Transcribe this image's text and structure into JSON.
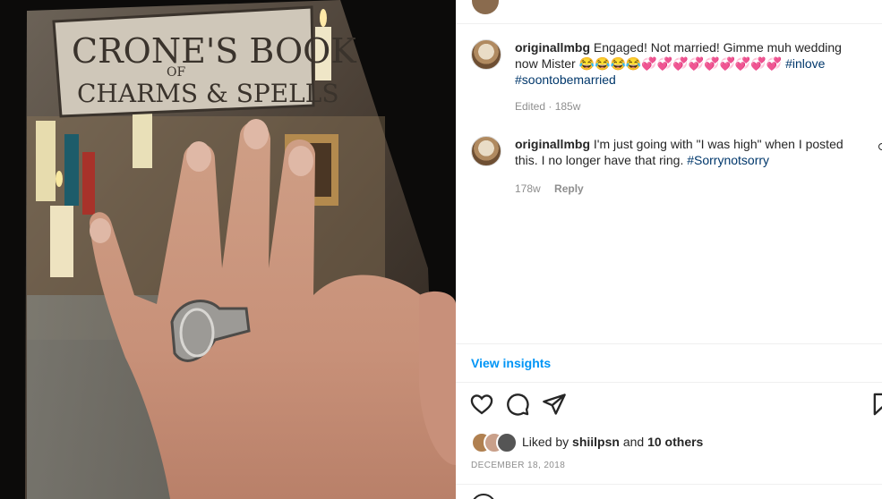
{
  "photo": {
    "book_title_line1": "CRONE'S BOOK",
    "book_title_line2": "OF",
    "book_title_line3": "CHARMS & SPELLS"
  },
  "comments": [
    {
      "username": "originallmbg",
      "text": "Engaged! Not married! Gimme muh wedding now Mister",
      "emojis": "😂😂😂😂💞💞💞💞💞💞💞💞💞",
      "hashtag1": "#inlove",
      "hashtag2": "#soontobemarried",
      "edited": "Edited",
      "time": "185w"
    },
    {
      "username": "originallmbg",
      "text": "I'm just going with \"I was high\" when I posted this. I no longer have that ring.",
      "hashtag1": "#Sorrynotsorry",
      "time": "178w",
      "reply": "Reply"
    }
  ],
  "insights_label": "View insights",
  "actions": {
    "like": "heart-icon",
    "comment": "comment-icon",
    "share": "paper-plane-icon",
    "save": "bookmark-icon"
  },
  "likes": {
    "prefix": "Liked by",
    "user": "shiilpsn",
    "joiner": "and",
    "others": "10 others"
  },
  "date": "DECEMBER 18, 2018",
  "colors": {
    "link": "#0095f6",
    "hashtag": "#00376b",
    "muted": "#8e8e8e",
    "text": "#262626"
  }
}
